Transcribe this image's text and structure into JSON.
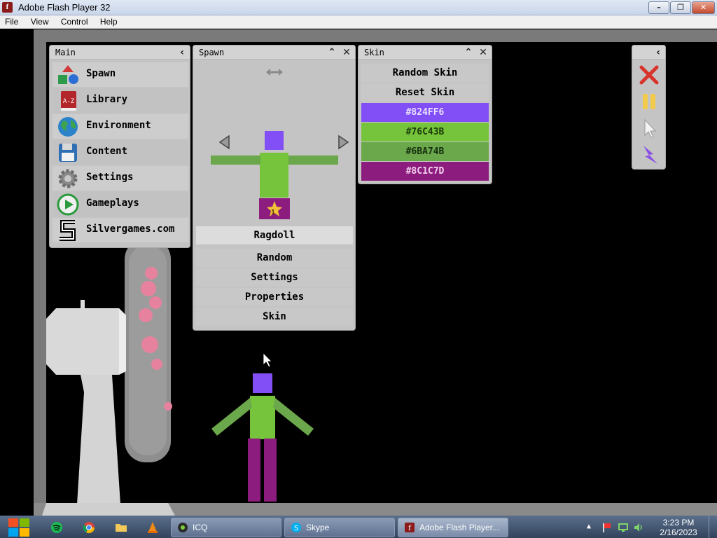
{
  "window": {
    "title": "Adobe Flash Player 32",
    "minimize_glyph": "–",
    "restore_glyph": "❐",
    "close_glyph": "✕"
  },
  "menu": [
    "File",
    "View",
    "Control",
    "Help"
  ],
  "main_panel": {
    "title": "Main",
    "items": [
      {
        "label": "Spawn",
        "icon": "shapes-icon"
      },
      {
        "label": "Library",
        "icon": "book-az-icon"
      },
      {
        "label": "Environment",
        "icon": "globe-icon"
      },
      {
        "label": "Content",
        "icon": "floppy-disk-icon"
      },
      {
        "label": "Settings",
        "icon": "gear-icon"
      },
      {
        "label": "Gameplays",
        "icon": "play-icon"
      },
      {
        "label": "Silvergames.com",
        "icon": "silvergames-s-icon"
      }
    ]
  },
  "spawn_panel": {
    "title": "Spawn",
    "selected": "Ragdoll",
    "badge": "1",
    "buttons": [
      "Random",
      "Settings",
      "Properties",
      "Skin"
    ]
  },
  "skin_panel": {
    "title": "Skin",
    "buttons": [
      "Random Skin",
      "Reset Skin"
    ],
    "swatches": [
      "#824FF6",
      "#76C43B",
      "#6BA74B",
      "#8C1C7D"
    ]
  },
  "colors": {
    "head": "#824FF6",
    "torso": "#76C43B",
    "arms": "#6BA74B",
    "legs": "#8C1C7D"
  },
  "toolbox": {
    "tools": [
      "delete-x-icon",
      "pause-icon",
      "cursor-icon",
      "lightning-icon"
    ]
  },
  "taskbar": {
    "tasks": [
      "ICQ",
      "Skype",
      "Adobe Flash Player..."
    ],
    "time": "3:23 PM",
    "date": "2/16/2023"
  }
}
